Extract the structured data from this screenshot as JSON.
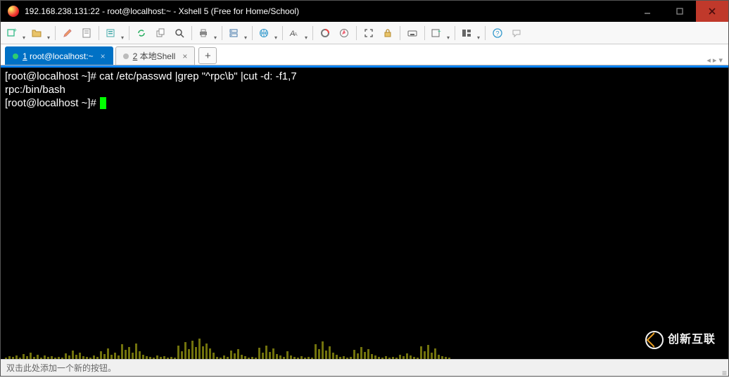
{
  "window": {
    "title": "192.168.238.131:22 - root@localhost:~ - Xshell 5 (Free for Home/School)"
  },
  "toolbar": {
    "icons": [
      {
        "name": "new-session-icon",
        "drop": true
      },
      {
        "name": "open-icon",
        "drop": true
      },
      {
        "sep": true
      },
      {
        "name": "pencil-icon",
        "drop": false
      },
      {
        "name": "script-icon",
        "drop": false
      },
      {
        "sep": true
      },
      {
        "name": "properties-icon",
        "drop": true
      },
      {
        "sep": true
      },
      {
        "name": "reconnect-icon",
        "drop": false
      },
      {
        "name": "copy-stack-icon",
        "drop": false
      },
      {
        "name": "find-icon",
        "drop": false
      },
      {
        "sep": true
      },
      {
        "name": "print-icon",
        "drop": true
      },
      {
        "sep": true
      },
      {
        "name": "server-icon",
        "drop": true
      },
      {
        "sep": true
      },
      {
        "name": "globe-icon",
        "drop": true
      },
      {
        "sep": true
      },
      {
        "name": "font-icon",
        "drop": true
      },
      {
        "sep": true
      },
      {
        "name": "activity-icon",
        "drop": false
      },
      {
        "name": "compass-icon",
        "drop": false
      },
      {
        "sep": true
      },
      {
        "name": "fullscreen-icon",
        "drop": false
      },
      {
        "name": "lock-icon",
        "drop": false
      },
      {
        "sep": true
      },
      {
        "name": "keyboard-icon",
        "drop": false
      },
      {
        "sep": true
      },
      {
        "name": "add-pane-icon",
        "drop": true
      },
      {
        "sep": true
      },
      {
        "name": "layout-icon",
        "drop": true
      },
      {
        "sep": true
      },
      {
        "name": "help-icon",
        "drop": false
      },
      {
        "name": "feedback-icon",
        "drop": false
      }
    ]
  },
  "tabs": {
    "items": [
      {
        "num": "1",
        "label": "root@localhost:~",
        "active": true
      },
      {
        "num": "2",
        "label": "本地Shell",
        "active": false
      }
    ]
  },
  "terminal": {
    "prompt1": "[root@localhost ~]# ",
    "cmd1": "cat /etc/passwd |grep \"^rpc\\b\" |cut -d: -f1,7",
    "out1": "rpc:/bin/bash",
    "prompt2": "[root@localhost ~]# "
  },
  "statusbar": {
    "hint": "双击此处添加一个新的按钮。"
  },
  "watermark": {
    "text": "创新互联"
  },
  "spectrum": [
    2,
    4,
    3,
    5,
    2,
    7,
    4,
    9,
    3,
    6,
    2,
    5,
    3,
    4,
    2,
    3,
    2,
    8,
    5,
    12,
    6,
    9,
    4,
    3,
    2,
    5,
    3,
    11,
    7,
    15,
    6,
    9,
    5,
    21,
    13,
    17,
    9,
    22,
    11,
    6,
    4,
    3,
    2,
    5,
    3,
    4,
    2,
    3,
    2,
    19,
    11,
    24,
    14,
    26,
    17,
    29,
    18,
    22,
    15,
    9,
    3,
    2,
    5,
    3,
    12,
    8,
    14,
    6,
    4,
    2,
    3,
    2,
    16,
    9,
    19,
    10,
    15,
    7,
    5,
    3,
    11,
    5,
    3,
    2,
    4,
    2,
    3,
    2,
    21,
    14,
    25,
    12,
    18,
    9,
    6,
    3,
    4,
    2,
    3,
    13,
    8,
    17,
    10,
    14,
    7,
    5,
    3,
    2,
    4,
    2,
    3,
    2,
    6,
    4,
    8,
    5,
    3,
    2,
    18,
    11,
    20,
    9,
    15,
    6,
    4,
    3,
    2
  ]
}
